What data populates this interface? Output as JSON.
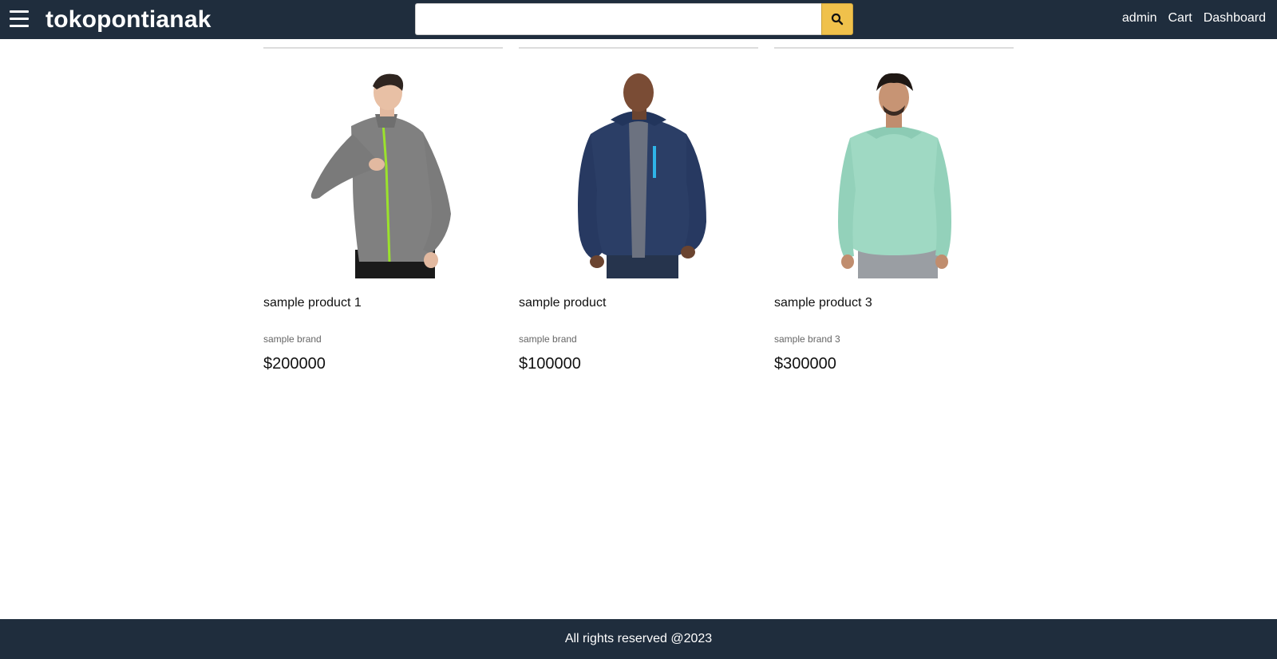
{
  "header": {
    "brand": "tokopontianak",
    "search": {
      "placeholder": "",
      "value": ""
    },
    "nav": [
      "admin",
      "Cart",
      "Dashboard"
    ]
  },
  "products": [
    {
      "name": "sample product 1",
      "brand": "sample brand",
      "price": "$200000",
      "image": "man-gray-zip-jacket"
    },
    {
      "name": "sample product",
      "brand": "sample brand",
      "price": "$100000",
      "image": "man-navy-hoodie-jacket"
    },
    {
      "name": "sample product 3",
      "brand": "sample brand 3",
      "price": "$300000",
      "image": "man-mint-hoodie"
    }
  ],
  "footer": {
    "text": "All rights reserved @2023"
  },
  "colors": {
    "header_bg": "#1f2d3d",
    "search_button": "#f0c14b",
    "text": "#111111"
  }
}
